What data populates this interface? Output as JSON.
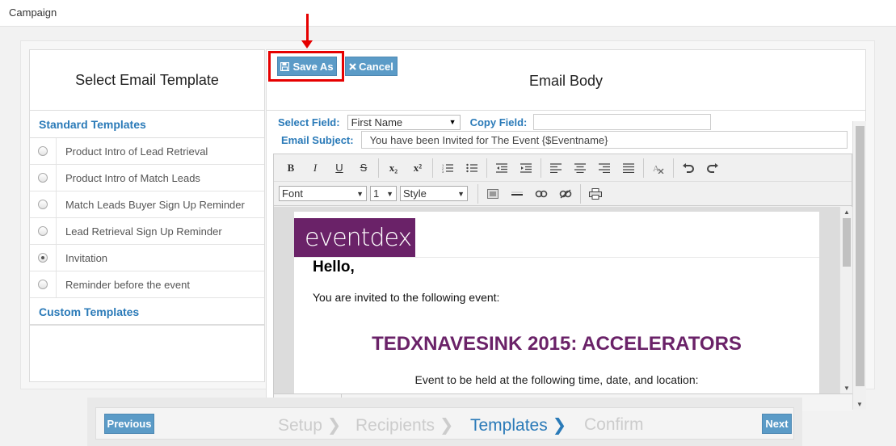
{
  "window": {
    "title": "Campaign"
  },
  "left_panel": {
    "title": "Select Email Template",
    "standard_header": "Standard Templates",
    "templates": [
      {
        "label": "Product Intro of Lead Retrieval",
        "selected": false
      },
      {
        "label": "Product Intro of Match Leads",
        "selected": false
      },
      {
        "label": "Match Leads Buyer Sign Up Reminder",
        "selected": false
      },
      {
        "label": "Lead Retrieval Sign Up Reminder",
        "selected": false
      },
      {
        "label": "Invitation",
        "selected": true
      },
      {
        "label": "Reminder before the event",
        "selected": false
      }
    ],
    "custom_header": "Custom Templates"
  },
  "right_panel": {
    "title": "Email Body",
    "save_label": "Save As",
    "cancel_label": "Cancel",
    "select_field_label": "Select Field:",
    "select_field_value": "First Name",
    "copy_field_label": "Copy Field:",
    "copy_field_value": "",
    "email_subject_label": "Email Subject:",
    "email_subject_value": "You have been Invited for The Event {$Eventname}"
  },
  "editor": {
    "toolbar1": [
      "B",
      "I",
      "U",
      "S",
      "x₂",
      "x²",
      "numbered-list",
      "bulleted-list",
      "outdent",
      "indent",
      "align-left",
      "align-center",
      "align-right",
      "justify",
      "remove-format",
      "undo",
      "redo"
    ],
    "font_label": "Font",
    "size_label": "1",
    "style_label": "Style",
    "source_label": "source"
  },
  "email_content": {
    "logo_text": "eventdex",
    "greeting": "Hello,",
    "intro": "You are invited to the following event:",
    "event_title": "TEDXNAVESINK 2015: ACCELERATORS",
    "event_sub": "Event to be held at the following time, date, and location:"
  },
  "wizard": {
    "previous_label": "Previous",
    "next_label": "Next",
    "steps": [
      "Setup",
      "Recipients",
      "Templates",
      "Confirm"
    ],
    "active_step": "Templates"
  },
  "colors": {
    "accent": "#2a7ab8",
    "button": "#5b9bc7",
    "brand": "#6a2268",
    "highlight": "#e60000"
  }
}
